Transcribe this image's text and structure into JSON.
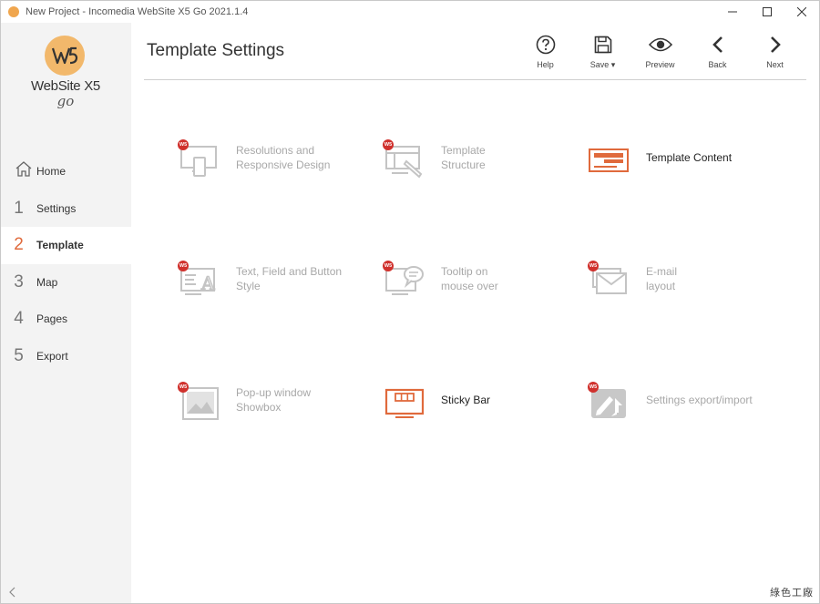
{
  "window": {
    "title": "New Project - Incomedia WebSite X5 Go 2021.1.4"
  },
  "logo": {
    "mark": "W5",
    "name": "WebSite X5",
    "edition": "go"
  },
  "sidebar": {
    "items": [
      {
        "num": "",
        "label": "Home",
        "icon": "home-icon",
        "active": false
      },
      {
        "num": "1",
        "label": "Settings",
        "active": false
      },
      {
        "num": "2",
        "label": "Template",
        "active": true
      },
      {
        "num": "3",
        "label": "Map",
        "active": false
      },
      {
        "num": "4",
        "label": "Pages",
        "active": false
      },
      {
        "num": "5",
        "label": "Export",
        "active": false
      }
    ]
  },
  "header": {
    "title": "Template Settings"
  },
  "toolbar": {
    "help": "Help",
    "save": "Save ▾",
    "preview": "Preview",
    "back": "Back",
    "next": "Next"
  },
  "tiles": [
    {
      "label": "Resolutions and\nResponsive Design",
      "enabled": false,
      "locked": true,
      "icon": "responsive-devices-icon"
    },
    {
      "label": "Template\nStructure",
      "enabled": false,
      "locked": true,
      "icon": "template-structure-icon"
    },
    {
      "label": "Template Content",
      "enabled": true,
      "locked": false,
      "icon": "template-content-icon"
    },
    {
      "label": "Text, Field and Button\nStyle",
      "enabled": false,
      "locked": true,
      "icon": "text-style-icon"
    },
    {
      "label": "Tooltip on\nmouse over",
      "enabled": false,
      "locked": true,
      "icon": "tooltip-icon"
    },
    {
      "label": "E-mail\nlayout",
      "enabled": false,
      "locked": true,
      "icon": "email-layout-icon"
    },
    {
      "label": "Pop-up window\nShowbox",
      "enabled": false,
      "locked": true,
      "icon": "showbox-icon"
    },
    {
      "label": "Sticky Bar",
      "enabled": true,
      "locked": false,
      "icon": "sticky-bar-icon"
    },
    {
      "label": "Settings export/import",
      "enabled": false,
      "locked": true,
      "icon": "settings-export-import-icon"
    }
  ],
  "badge_text": "W5",
  "colors": {
    "accent": "#e06a3c",
    "badge": "#d0312d",
    "disabled": "#c4c4c4",
    "logo": "#f2b86b"
  },
  "watermark": "綠色工廠"
}
